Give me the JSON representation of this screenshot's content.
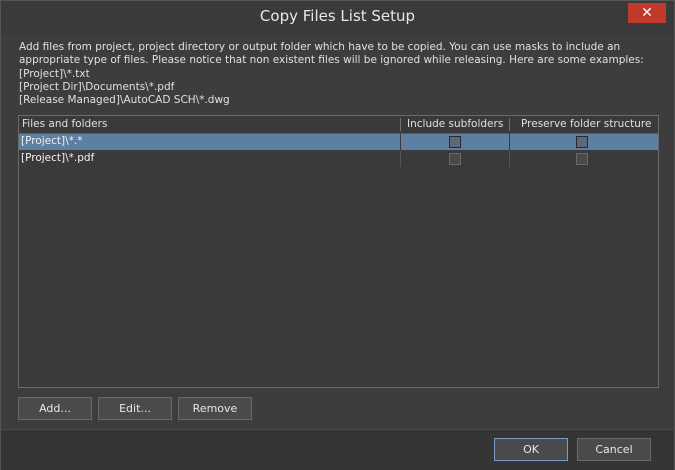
{
  "window": {
    "title": "Copy Files List Setup",
    "close_glyph": "✕"
  },
  "description": {
    "line1": "Add files from project, project directory or output folder which have to be copied. You can use masks to include an",
    "line2": "appropriate type of files. Please notice that non existent files will be ignored while releasing. Here are some examples:",
    "example1": "[Project]\\*.txt",
    "example2": "[Project Dir]\\Documents\\*.pdf",
    "example3": "[Release Managed]\\AutoCAD SCH\\*.dwg"
  },
  "table": {
    "columns": [
      "Files and folders",
      "Include subfolders",
      "Preserve folder structure"
    ],
    "rows": [
      {
        "path": "[Project]\\*.*",
        "include_subfolders": false,
        "preserve_structure": false,
        "selected": true
      },
      {
        "path": "[Project]\\*.pdf",
        "include_subfolders": false,
        "preserve_structure": false,
        "selected": false
      }
    ]
  },
  "buttons": {
    "add": "Add...",
    "edit": "Edit...",
    "remove": "Remove",
    "ok": "OK",
    "cancel": "Cancel"
  },
  "colors": {
    "close_button": "#c0392b",
    "selected_row": "#5d7fa3"
  }
}
